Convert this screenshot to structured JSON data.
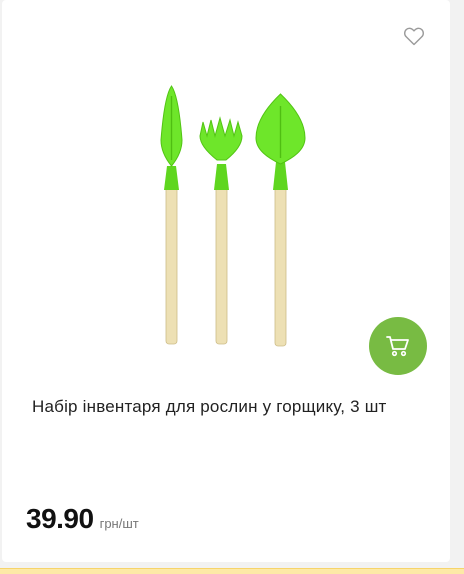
{
  "product": {
    "title": "Набір інвентаря для рослин у горщику, 3 шт",
    "price": "39.90",
    "unit": "грн/шт"
  },
  "icons": {
    "favorite": "heart-outline-icon",
    "cart": "cart-icon"
  },
  "colors": {
    "accent": "#78bb43",
    "tool_green": "#6ee62a",
    "handle": "#e9dcae"
  }
}
